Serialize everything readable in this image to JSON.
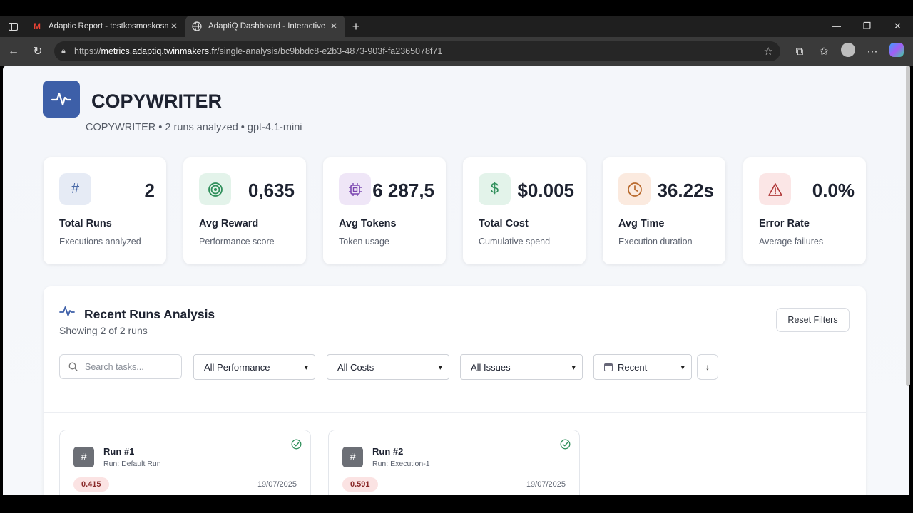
{
  "browser": {
    "tabs": [
      {
        "title": "Adaptic Report - testkosmoskosmos",
        "favicon": "gmail-icon",
        "active": false
      },
      {
        "title": "AdaptiQ Dashboard - Interactive",
        "favicon": "globe-icon",
        "active": true
      }
    ],
    "url_prefix": "https://",
    "url_host": "metrics.adaptiq.twinmakers.fr",
    "url_path": "/single-analysis/bc9bbdc8-e2b3-4873-903f-fa2365078f71"
  },
  "header": {
    "title": "COPYWRITER",
    "subtitle": "COPYWRITER • 2 runs analyzed • gpt-4.1-mini"
  },
  "stats": [
    {
      "value": "2",
      "label": "Total Runs",
      "sub": "Executions analyzed",
      "icon": "hash-icon",
      "bg": "#e6ebf5",
      "fg": "#4a6aa8"
    },
    {
      "value": "0,635",
      "label": "Avg Reward",
      "sub": "Performance score",
      "icon": "target-icon",
      "bg": "#e3f3ea",
      "fg": "#2e8f5a"
    },
    {
      "value": "6 287,5",
      "label": "Avg Tokens",
      "sub": "Token usage",
      "icon": "cpu-icon",
      "bg": "#efe6f7",
      "fg": "#7a45b0"
    },
    {
      "value": "$0.005",
      "label": "Total Cost",
      "sub": "Cumulative spend",
      "icon": "dollar-icon",
      "bg": "#e3f3ea",
      "fg": "#2e8f5a"
    },
    {
      "value": "36.22s",
      "label": "Avg Time",
      "sub": "Execution duration",
      "icon": "clock-icon",
      "bg": "#fbeadf",
      "fg": "#b96a2e"
    },
    {
      "value": "0.0%",
      "label": "Error Rate",
      "sub": "Average failures",
      "icon": "warning-icon",
      "bg": "#fbe6e6",
      "fg": "#b03a3a"
    }
  ],
  "runs_panel": {
    "title": "Recent Runs Analysis",
    "subtitle": "Showing 2 of 2 runs",
    "reset_label": "Reset Filters",
    "search_placeholder": "Search tasks...",
    "filters": {
      "performance": "All Performance",
      "costs": "All Costs",
      "issues": "All Issues",
      "sort": "Recent"
    },
    "sort_direction": "↓"
  },
  "runs": [
    {
      "title": "Run #1",
      "sub": "Run: Default Run",
      "score": "0.415",
      "date": "19/07/2025"
    },
    {
      "title": "Run #2",
      "sub": "Run: Execution-1",
      "score": "0.591",
      "date": "19/07/2025"
    }
  ],
  "colors": {
    "accent": "#3d5fa8",
    "success": "#2e8f5a"
  }
}
